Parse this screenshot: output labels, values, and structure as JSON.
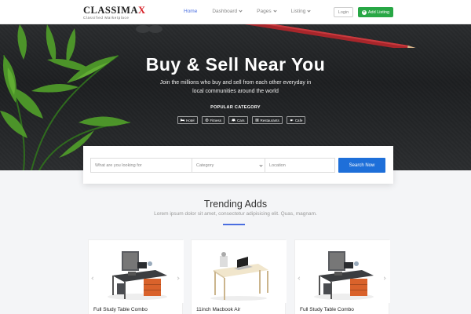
{
  "brand": {
    "name_main": "CLASSIMA",
    "name_accent": "X",
    "tagline": "Classified Marketplace",
    "accent_color": "#d61f26"
  },
  "nav": {
    "items": [
      {
        "label": "Home",
        "active": true,
        "dropdown": false
      },
      {
        "label": "Dashboard",
        "active": false,
        "dropdown": true
      },
      {
        "label": "Pages",
        "active": false,
        "dropdown": true
      },
      {
        "label": "Listing",
        "active": false,
        "dropdown": true
      }
    ],
    "login_label": "Login",
    "add_listing_label": "Add Listing"
  },
  "hero": {
    "title": "Buy & Sell Near You",
    "subtitle": "Join the millions who buy and sell from each other everyday in local communities around the world",
    "popular_label": "POPULAR CATEGORY",
    "categories": [
      {
        "label": "Hotel",
        "icon": "bed-icon"
      },
      {
        "label": "Fitness",
        "icon": "fitness-icon"
      },
      {
        "label": "Cars",
        "icon": "car-icon"
      },
      {
        "label": "Restaurants",
        "icon": "restaurant-icon"
      },
      {
        "label": "Cafe",
        "icon": "coffee-icon"
      }
    ]
  },
  "search": {
    "keyword_placeholder": "What are you looking for",
    "category_value": "Category",
    "location_placeholder": "Location",
    "button_label": "Search Now"
  },
  "trending": {
    "title": "Trending Adds",
    "subtitle": "Lorem ipsum dolor sit amet, consectetur adipisicing elit. Quas, magnam.",
    "items": [
      {
        "title": "Full Study Table Combo"
      },
      {
        "title": "11inch Macbook Air"
      },
      {
        "title": "Full Study Table Combo"
      }
    ]
  },
  "colors": {
    "primary": "#1e6fd9",
    "success": "#28a745",
    "nav_active": "#4a6ee0"
  }
}
